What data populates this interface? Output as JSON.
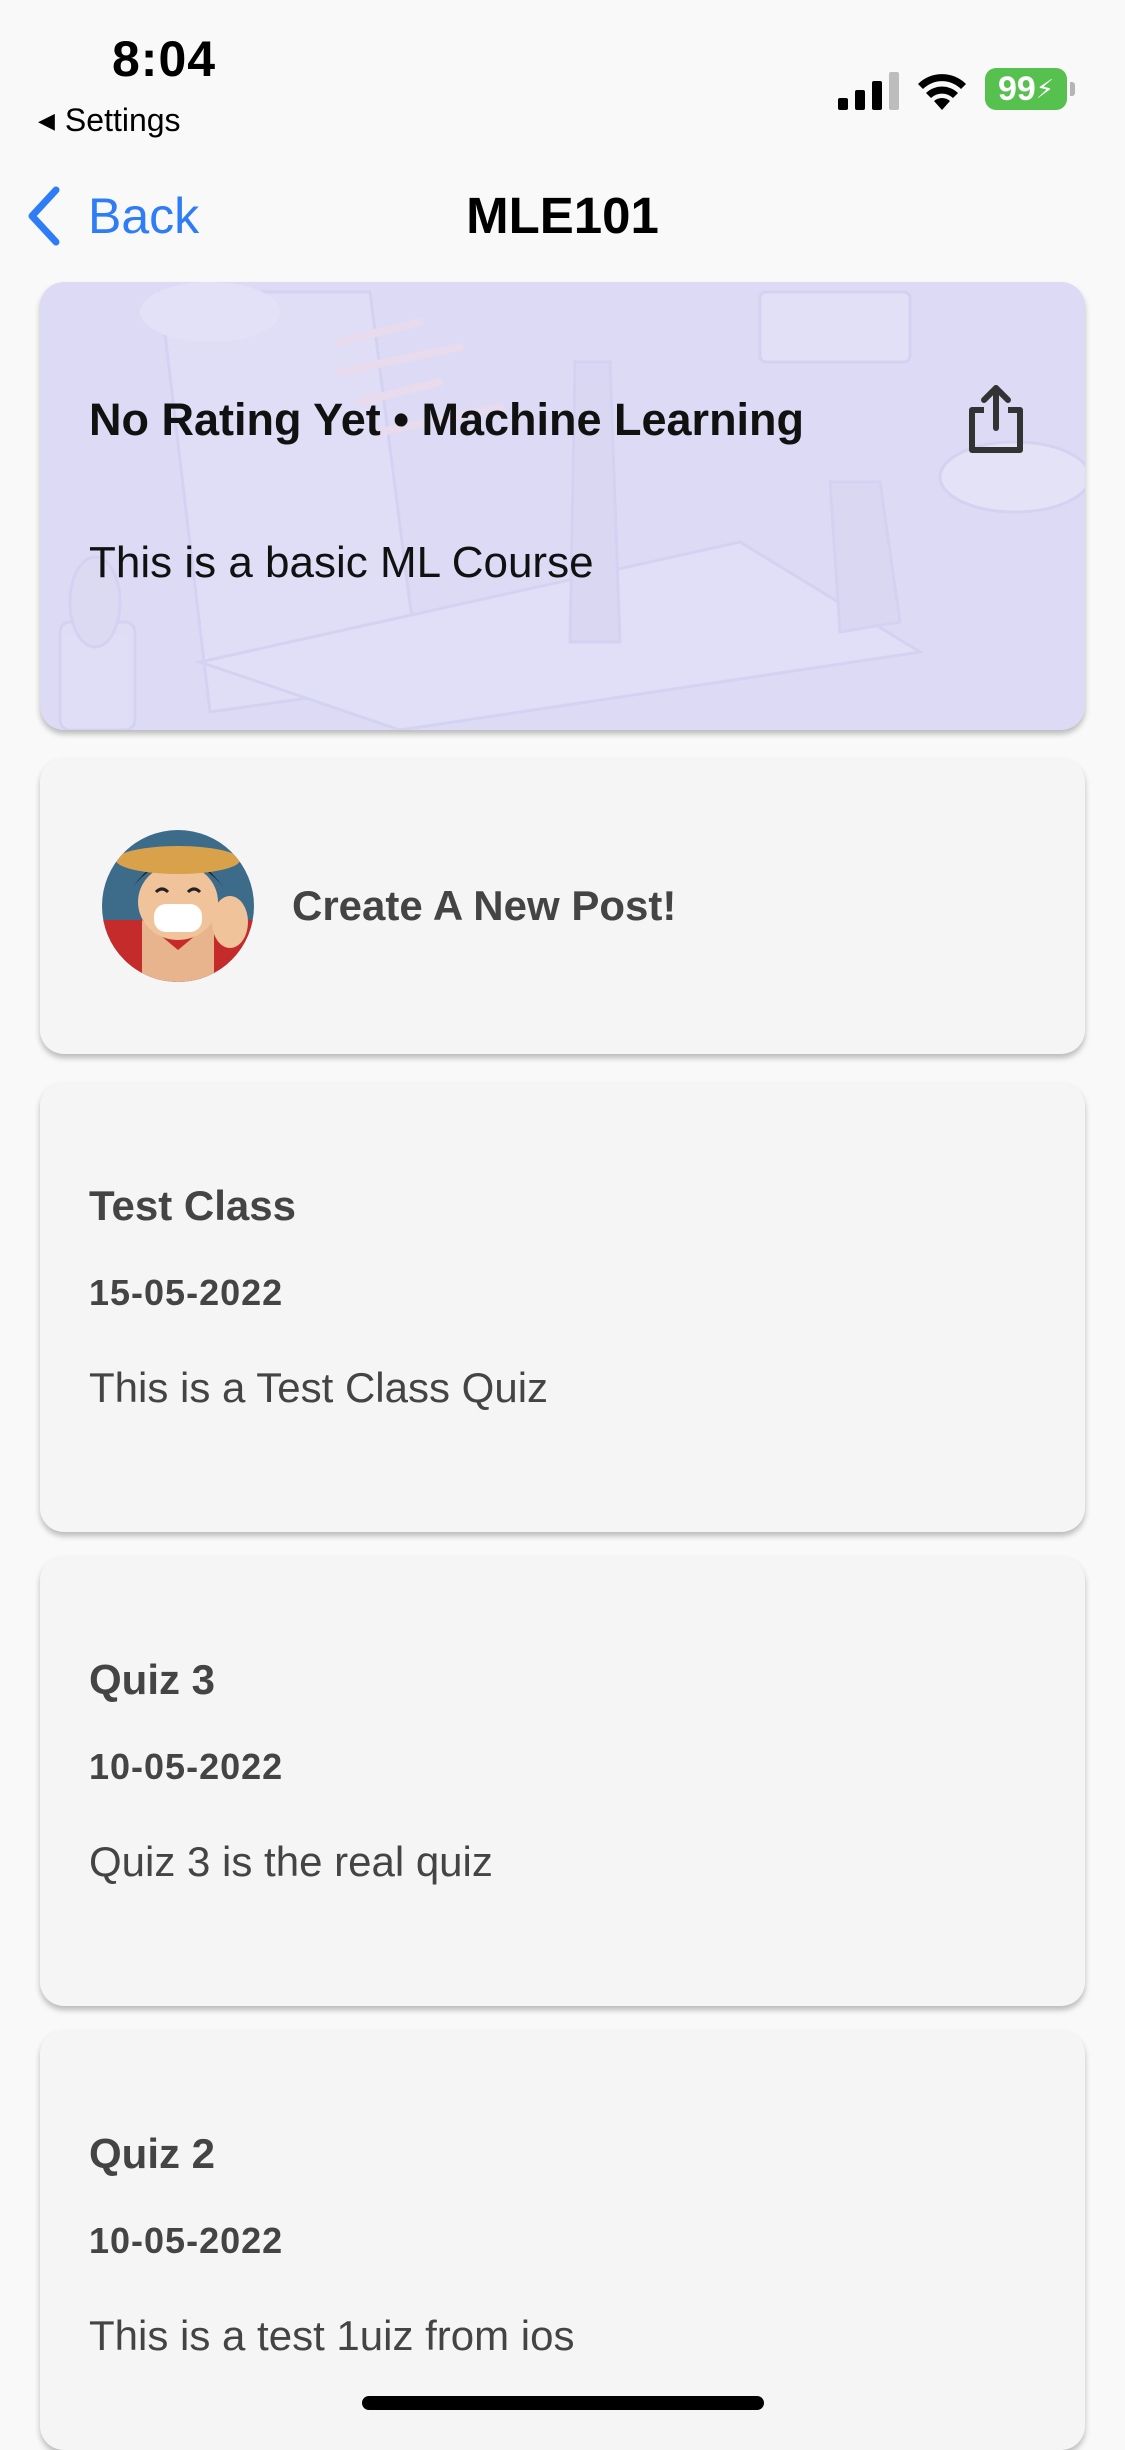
{
  "status_bar": {
    "time": "8:04",
    "back_app": "Settings",
    "battery": "99"
  },
  "nav": {
    "back_label": "Back",
    "title": "MLE101"
  },
  "course": {
    "header": "No Rating Yet • Machine Learning",
    "description": "This is a basic ML Course"
  },
  "create_post": {
    "label": "Create A New Post!"
  },
  "posts": [
    {
      "title": "Test Class",
      "date": "15-05-2022",
      "description": "This is a Test Class Quiz"
    },
    {
      "title": "Quiz 3",
      "date": "10-05-2022",
      "description": "Quiz 3 is the real quiz"
    },
    {
      "title": "Quiz 2",
      "date": "10-05-2022",
      "description": "This is a test 1uiz from ios"
    }
  ],
  "colors": {
    "accent": "#2e7cf6",
    "course_card_bg": "#dcdaf4",
    "battery_green": "#57c14f"
  }
}
